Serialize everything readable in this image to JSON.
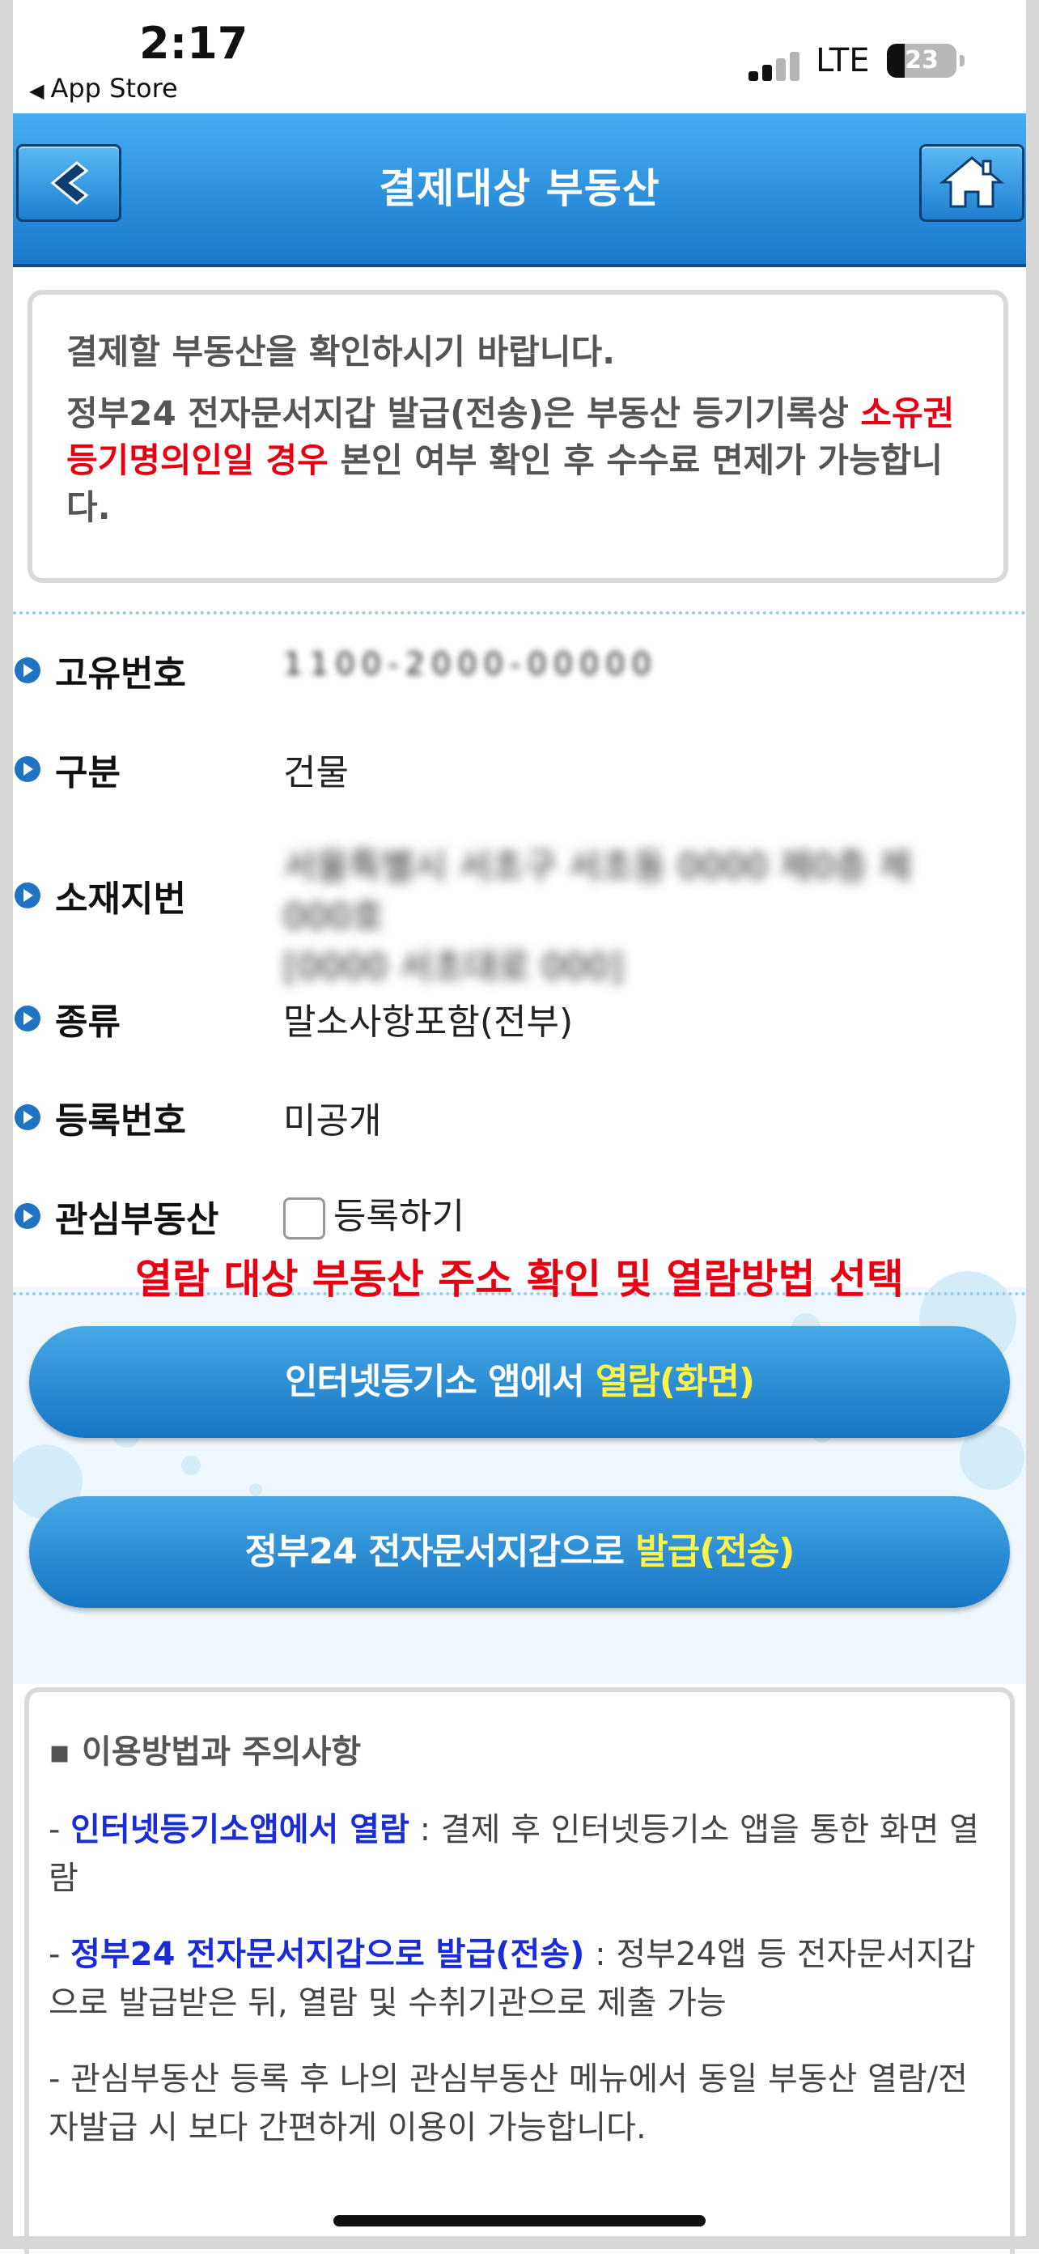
{
  "status_bar": {
    "time": "2:17",
    "back_label": "App Store",
    "network": "LTE",
    "battery": "23"
  },
  "header": {
    "title": "결제대상 부동산"
  },
  "notice": {
    "line1": "결제할 부동산을 확인하시기 바랍니다.",
    "line2_a": "정부24 전자문서지갑 발급(전송)은 부동산 등기기록상 ",
    "line2_red": "소유권 등기명의인일 경우",
    "line2_b": " 본인 여부 확인 후 수수료 면제가 가능합니다."
  },
  "fields": {
    "unique_no_label": "고유번호",
    "unique_no_value": "1 1 0 0 - 2 0 0 0 - 0 0 0 0 0",
    "type_label": "구분",
    "type_value": "건물",
    "address_label": "소재지번",
    "address_value_line1": "서울특별시 서초구 서초동 0000 제0층 제000호",
    "address_value_line2": "[0000 서초대로 000]",
    "kind_label": "종류",
    "kind_value": "말소사항포함(전부)",
    "reg_no_label": "등록번호",
    "reg_no_value": "미공개",
    "favorite_label": "관심부동산",
    "favorite_checkbox_label": "등록하기"
  },
  "guide_note": "열람 대상 부동산 주소 확인 및 열람방법 선택",
  "buttons": {
    "view_prefix": "인터넷등기소 앱에서 ",
    "view_highlight": "열람(화면)",
    "issue_prefix": "정부24 전자문서지갑으로 ",
    "issue_highlight": "발급(전송)"
  },
  "usage": {
    "section_title": "▪ 이용방법과 주의사항",
    "item1_dash": "- ",
    "item1_title": "인터넷등기소앱에서 열람",
    "item1_text": " : 결제 후 인터넷등기소 앱을 통한 화면 열람",
    "item2_dash": "- ",
    "item2_title": "정부24 전자문서지갑으로 발급(전송)",
    "item2_text": " : 정부24앱 등 전자문서지갑으로 발급받은 뒤, 열람 및 수취기관으로 제출 가능",
    "item3": "- 관심부동산 등록 후 나의 관심부동산 메뉴에서 동일 부동산 열람/전자발급 시 보다 간편하게 이용이 가능합니다."
  },
  "colors": {
    "header_blue": "#1a78cc",
    "button_blue": "#1676c4",
    "alert_red": "#e60012",
    "highlight_yellow": "#fff34a",
    "link_blue": "#1a2bd8"
  }
}
